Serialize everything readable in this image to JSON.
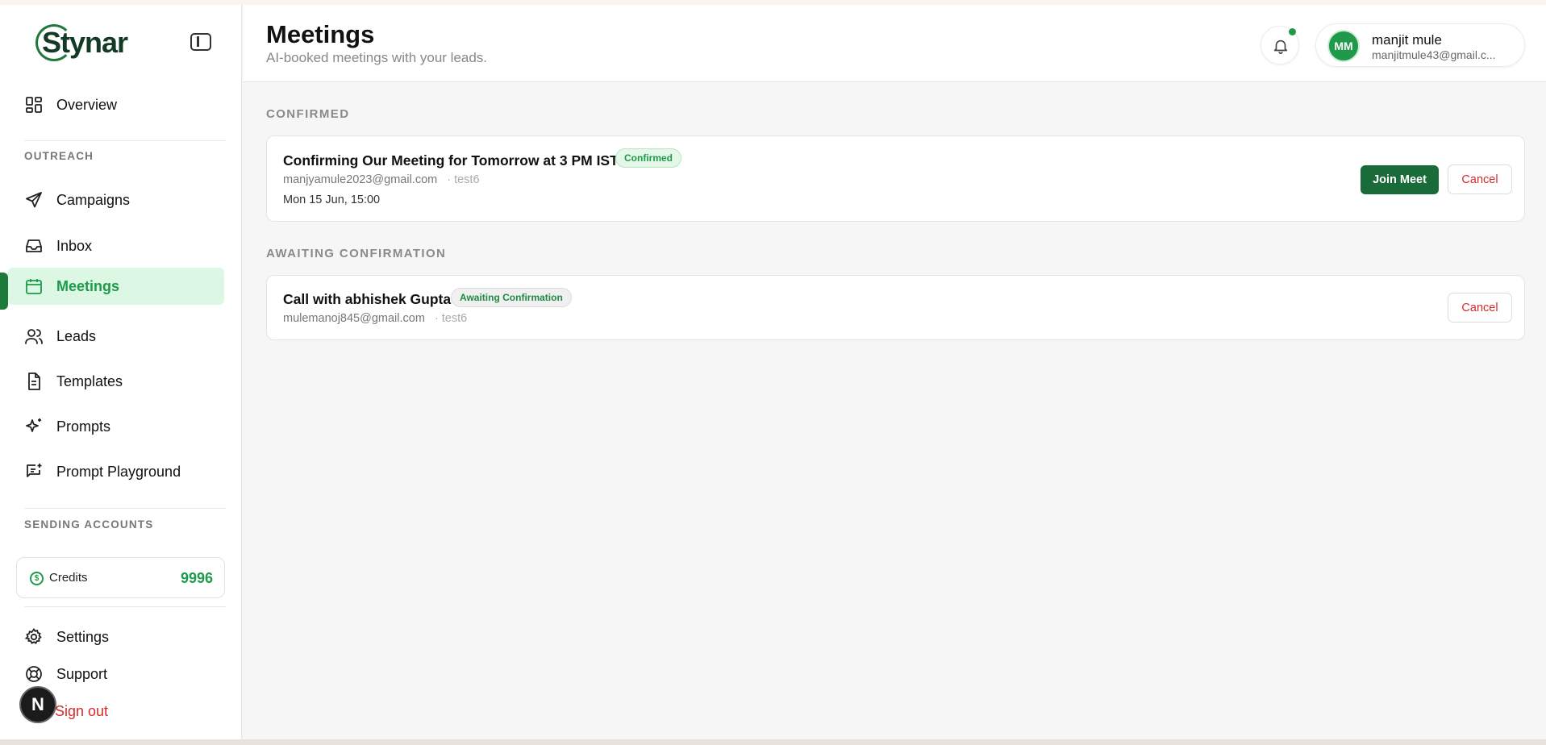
{
  "brand": {
    "logo_text": "Stynar"
  },
  "sidebar": {
    "items": [
      {
        "label": "Overview",
        "icon": "grid-icon"
      },
      {
        "label": "Campaigns",
        "icon": "send-icon"
      },
      {
        "label": "Inbox",
        "icon": "inbox-icon"
      },
      {
        "label": "Meetings",
        "icon": "calendar-icon",
        "active": true
      },
      {
        "label": "Leads",
        "icon": "users-icon"
      },
      {
        "label": "Templates",
        "icon": "document-icon"
      },
      {
        "label": "Prompts",
        "icon": "sparkle-icon"
      },
      {
        "label": "Prompt Playground",
        "icon": "chat-sparkle-icon"
      }
    ],
    "section_outreach": "OUTREACH",
    "section_sending": "SENDING ACCOUNTS",
    "credits": {
      "label": "Credits",
      "value": "9996",
      "icon": "dollar-circle-icon"
    },
    "settings": "Settings",
    "support": "Support",
    "signout": "Sign out",
    "floating_badge": "N"
  },
  "header": {
    "title": "Meetings",
    "subtitle": "AI-booked meetings with your leads.",
    "user": {
      "initials": "MM",
      "name": "manjit mule",
      "email": "manjitmule43@gmail.c..."
    }
  },
  "groups": [
    {
      "label": "CONFIRMED",
      "meetings": [
        {
          "title": "Confirming Our Meeting for Tomorrow at 3 PM IST",
          "status": "Confirmed",
          "email": "manjyamule2023@gmail.com",
          "campaign": "· test6",
          "when": "Mon 15 Jun, 15:00",
          "join_label": "Join Meet",
          "cancel_label": "Cancel"
        }
      ]
    },
    {
      "label": "AWAITING CONFIRMATION",
      "meetings": [
        {
          "title": "Call with abhishek Gupta",
          "status": "Awaiting Confirmation",
          "email": "mulemanoj845@gmail.com",
          "campaign": "· test6",
          "cancel_label": "Cancel"
        }
      ]
    }
  ],
  "colors": {
    "accent": "#1e9a4a",
    "accent_dark": "#1a6b3a",
    "danger": "#d62b2b",
    "active_bg": "#dcf7e3"
  }
}
